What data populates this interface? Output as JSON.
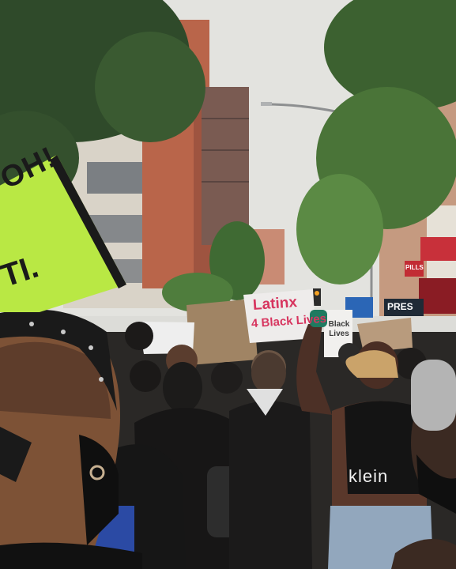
{
  "photo": {
    "signs": {
      "left_green": [
        "OH!",
        "TI."
      ],
      "center_pink": [
        "Latinx",
        "4 Black Lives"
      ],
      "small_right": "Black Lives"
    },
    "street_signs": {
      "store_banner": "PRES",
      "red_sign": "PILLS"
    },
    "clothing": {
      "sports_bra_logo": "klein"
    }
  }
}
